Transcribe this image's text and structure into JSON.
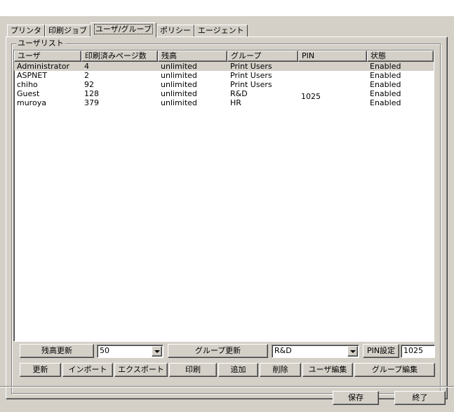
{
  "tabs": [
    {
      "label": "プリンタ",
      "active": false
    },
    {
      "label": "印刷ジョブ",
      "active": false
    },
    {
      "label": "ユーザ/グループ",
      "active": true
    },
    {
      "label": "ポリシー",
      "active": false
    },
    {
      "label": "エージェント",
      "active": false
    }
  ],
  "user_list": {
    "title": "ユーザリスト",
    "columns": [
      "ユーザ",
      "印刷済みページ数",
      "残高",
      "グループ",
      "PIN",
      "状態"
    ],
    "rows": [
      {
        "user": "Administrator",
        "pages": "4",
        "balance": "unlimited",
        "group": "Print Users",
        "pin": "",
        "status": "Enabled"
      },
      {
        "user": "ASPNET",
        "pages": "2",
        "balance": "unlimited",
        "group": "Print Users",
        "pin": "",
        "status": "Enabled"
      },
      {
        "user": "chiho",
        "pages": "92",
        "balance": "unlimited",
        "group": "Print Users",
        "pin": "",
        "status": "Enabled"
      },
      {
        "user": "Guest",
        "pages": "128",
        "balance": "unlimited",
        "group": "R&D",
        "pin": "1025",
        "status": "Enabled"
      },
      {
        "user": "muroya",
        "pages": "379",
        "balance": "unlimited",
        "group": "HR",
        "pin": "",
        "status": "Enabled"
      }
    ]
  },
  "controls": {
    "balance_update_label": "残高更新",
    "balance_value": "50",
    "group_update_label": "グループ更新",
    "group_value": "R&D",
    "pin_set_label": "PIN設定",
    "pin_value": "1025"
  },
  "actions": {
    "refresh": "更新",
    "import": "インポート",
    "export": "エクスポート",
    "print": "印刷",
    "add": "追加",
    "delete": "削除",
    "edit_user": "ユーザ編集",
    "edit_group": "グループ編集"
  },
  "footer": {
    "save": "保存",
    "exit": "終了"
  }
}
